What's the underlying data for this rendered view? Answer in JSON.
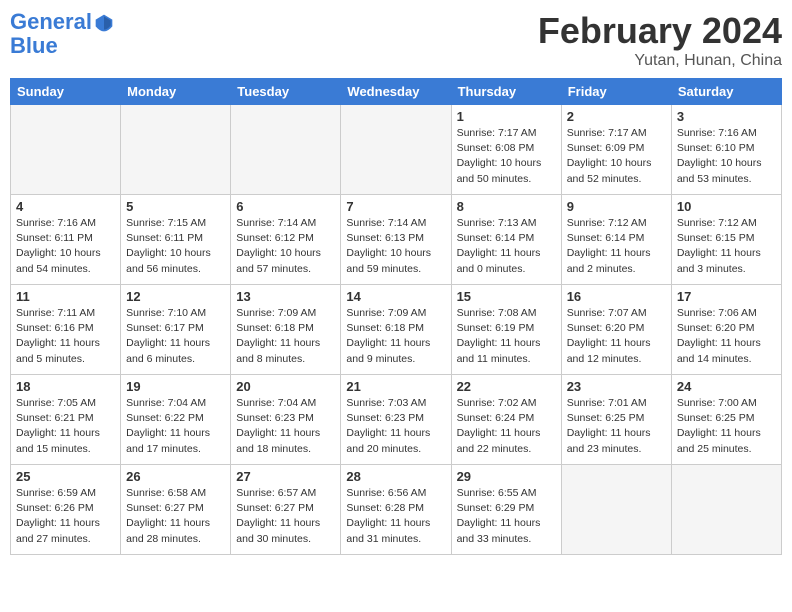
{
  "header": {
    "logo_line1": "General",
    "logo_line2": "Blue",
    "month": "February 2024",
    "location": "Yutan, Hunan, China"
  },
  "days_of_week": [
    "Sunday",
    "Monday",
    "Tuesday",
    "Wednesday",
    "Thursday",
    "Friday",
    "Saturday"
  ],
  "weeks": [
    [
      {
        "day": "",
        "info": "",
        "empty": true
      },
      {
        "day": "",
        "info": "",
        "empty": true
      },
      {
        "day": "",
        "info": "",
        "empty": true
      },
      {
        "day": "",
        "info": "",
        "empty": true
      },
      {
        "day": "1",
        "info": "Sunrise: 7:17 AM\nSunset: 6:08 PM\nDaylight: 10 hours\nand 50 minutes."
      },
      {
        "day": "2",
        "info": "Sunrise: 7:17 AM\nSunset: 6:09 PM\nDaylight: 10 hours\nand 52 minutes."
      },
      {
        "day": "3",
        "info": "Sunrise: 7:16 AM\nSunset: 6:10 PM\nDaylight: 10 hours\nand 53 minutes."
      }
    ],
    [
      {
        "day": "4",
        "info": "Sunrise: 7:16 AM\nSunset: 6:11 PM\nDaylight: 10 hours\nand 54 minutes."
      },
      {
        "day": "5",
        "info": "Sunrise: 7:15 AM\nSunset: 6:11 PM\nDaylight: 10 hours\nand 56 minutes."
      },
      {
        "day": "6",
        "info": "Sunrise: 7:14 AM\nSunset: 6:12 PM\nDaylight: 10 hours\nand 57 minutes."
      },
      {
        "day": "7",
        "info": "Sunrise: 7:14 AM\nSunset: 6:13 PM\nDaylight: 10 hours\nand 59 minutes."
      },
      {
        "day": "8",
        "info": "Sunrise: 7:13 AM\nSunset: 6:14 PM\nDaylight: 11 hours\nand 0 minutes."
      },
      {
        "day": "9",
        "info": "Sunrise: 7:12 AM\nSunset: 6:14 PM\nDaylight: 11 hours\nand 2 minutes."
      },
      {
        "day": "10",
        "info": "Sunrise: 7:12 AM\nSunset: 6:15 PM\nDaylight: 11 hours\nand 3 minutes."
      }
    ],
    [
      {
        "day": "11",
        "info": "Sunrise: 7:11 AM\nSunset: 6:16 PM\nDaylight: 11 hours\nand 5 minutes."
      },
      {
        "day": "12",
        "info": "Sunrise: 7:10 AM\nSunset: 6:17 PM\nDaylight: 11 hours\nand 6 minutes."
      },
      {
        "day": "13",
        "info": "Sunrise: 7:09 AM\nSunset: 6:18 PM\nDaylight: 11 hours\nand 8 minutes."
      },
      {
        "day": "14",
        "info": "Sunrise: 7:09 AM\nSunset: 6:18 PM\nDaylight: 11 hours\nand 9 minutes."
      },
      {
        "day": "15",
        "info": "Sunrise: 7:08 AM\nSunset: 6:19 PM\nDaylight: 11 hours\nand 11 minutes."
      },
      {
        "day": "16",
        "info": "Sunrise: 7:07 AM\nSunset: 6:20 PM\nDaylight: 11 hours\nand 12 minutes."
      },
      {
        "day": "17",
        "info": "Sunrise: 7:06 AM\nSunset: 6:20 PM\nDaylight: 11 hours\nand 14 minutes."
      }
    ],
    [
      {
        "day": "18",
        "info": "Sunrise: 7:05 AM\nSunset: 6:21 PM\nDaylight: 11 hours\nand 15 minutes."
      },
      {
        "day": "19",
        "info": "Sunrise: 7:04 AM\nSunset: 6:22 PM\nDaylight: 11 hours\nand 17 minutes."
      },
      {
        "day": "20",
        "info": "Sunrise: 7:04 AM\nSunset: 6:23 PM\nDaylight: 11 hours\nand 18 minutes."
      },
      {
        "day": "21",
        "info": "Sunrise: 7:03 AM\nSunset: 6:23 PM\nDaylight: 11 hours\nand 20 minutes."
      },
      {
        "day": "22",
        "info": "Sunrise: 7:02 AM\nSunset: 6:24 PM\nDaylight: 11 hours\nand 22 minutes."
      },
      {
        "day": "23",
        "info": "Sunrise: 7:01 AM\nSunset: 6:25 PM\nDaylight: 11 hours\nand 23 minutes."
      },
      {
        "day": "24",
        "info": "Sunrise: 7:00 AM\nSunset: 6:25 PM\nDaylight: 11 hours\nand 25 minutes."
      }
    ],
    [
      {
        "day": "25",
        "info": "Sunrise: 6:59 AM\nSunset: 6:26 PM\nDaylight: 11 hours\nand 27 minutes."
      },
      {
        "day": "26",
        "info": "Sunrise: 6:58 AM\nSunset: 6:27 PM\nDaylight: 11 hours\nand 28 minutes."
      },
      {
        "day": "27",
        "info": "Sunrise: 6:57 AM\nSunset: 6:27 PM\nDaylight: 11 hours\nand 30 minutes."
      },
      {
        "day": "28",
        "info": "Sunrise: 6:56 AM\nSunset: 6:28 PM\nDaylight: 11 hours\nand 31 minutes."
      },
      {
        "day": "29",
        "info": "Sunrise: 6:55 AM\nSunset: 6:29 PM\nDaylight: 11 hours\nand 33 minutes."
      },
      {
        "day": "",
        "info": "",
        "empty": true
      },
      {
        "day": "",
        "info": "",
        "empty": true
      }
    ]
  ]
}
